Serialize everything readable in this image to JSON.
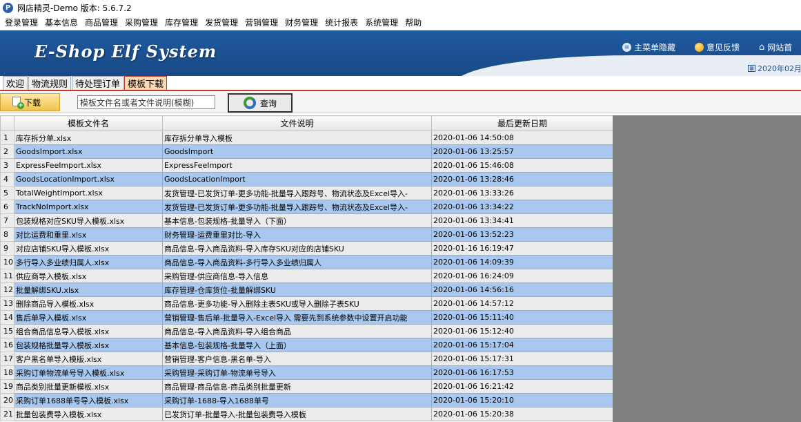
{
  "window": {
    "title": "网店精灵-Demo  版本: 5.6.7.2",
    "icon": "app-logo-icon"
  },
  "menu": [
    "登录管理",
    "基本信息",
    "商品管理",
    "采购管理",
    "库存管理",
    "发货管理",
    "营销管理",
    "财务管理",
    "统计报表",
    "系统管理",
    "帮助"
  ],
  "banner": {
    "logo": "E-Shop Elf System",
    "links": {
      "hide_menu": "主菜单隐藏",
      "feedback": "意见反馈",
      "homepage": "网站首"
    },
    "date": "2020年02月"
  },
  "tabs": [
    "欢迎",
    "物流规则",
    "待处理订单",
    "模板下载"
  ],
  "active_tab": 3,
  "toolbar": {
    "download_label": "下载",
    "search_value": "模板文件名或者文件说明(模糊)",
    "query_label": "查询"
  },
  "table": {
    "headers": [
      "",
      "模板文件名",
      "文件说明",
      "最后更新日期"
    ],
    "rows": [
      [
        "1",
        "库存拆分单.xlsx",
        "库存拆分单导入模板",
        "2020-01-06 14:50:08"
      ],
      [
        "2",
        "GoodsImport.xlsx",
        "GoodsImport",
        "2020-01-06 13:25:57"
      ],
      [
        "3",
        "ExpressFeeImport.xlsx",
        "ExpressFeeImport",
        "2020-01-06 15:46:08"
      ],
      [
        "4",
        "GoodsLocationImport.xlsx",
        "GoodsLocationImport",
        "2020-01-06 13:28:46"
      ],
      [
        "5",
        "TotalWeightImport.xlsx",
        "发货管理-已发货订单-更多功能-批量导入跟踪号、物流状态及Excel导入-",
        "2020-01-06 13:33:26"
      ],
      [
        "6",
        "TrackNoImport.xlsx",
        "发货管理-已发货订单-更多功能-批量导入跟踪号、物流状态及Excel导入-",
        "2020-01-06 13:34:22"
      ],
      [
        "7",
        "包装规格对应SKU导入模板.xlsx",
        "基本信息-包装规格-批量导入（下面）",
        "2020-01-06 13:34:41"
      ],
      [
        "8",
        "对比运费和重里.xlsx",
        "财务管理-运费重里对比-导入",
        "2020-01-06 13:52:23"
      ],
      [
        "9",
        "对应店铺SKU导入模板.xlsx",
        "商品信息-导入商品资料-导入库存SKU对应的店铺SKU",
        "2020-01-16 16:19:47"
      ],
      [
        "10",
        "多行导入多业绩归属人.xlsx",
        "商品信息-导入商品资料-多行导入多业绩归属人",
        "2020-01-06 14:09:39"
      ],
      [
        "11",
        "供应商导入模板.xlsx",
        "采购管理-供应商信息-导入信息",
        "2020-01-06 16:24:09"
      ],
      [
        "12",
        "批量解绑SKU.xlsx",
        "库存管理-仓库货位-批量解绑SKU",
        "2020-01-06 14:56:16"
      ],
      [
        "13",
        "删除商品导入模板.xlsx",
        "商品信息-更多功能-导入删除主表SKU或导入删除子表SKU",
        "2020-01-06 14:57:12"
      ],
      [
        "14",
        "售后单导入模板.xlsx",
        "营销管理-售后单-批量导入-Excel导入 需要先到系统参数中设置开启功能",
        "2020-01-06 15:11:40"
      ],
      [
        "15",
        "组合商品信息导入模板.xlsx",
        "商品信息-导入商品资料-导入组合商品",
        "2020-01-06 15:12:40"
      ],
      [
        "16",
        "包装规格批量导入模板.xlsx",
        "基本信息-包装规格-批量导入（上面）",
        "2020-01-06 15:17:04"
      ],
      [
        "17",
        "客户黑名单导入模版.xlsx",
        "营销管理-客户信息-黑名单-导入",
        "2020-01-06 15:17:31"
      ],
      [
        "18",
        "采购订单物流单号导入模板.xlsx",
        "采购管理-采购订单-物流单号导入",
        "2020-01-06 16:17:53"
      ],
      [
        "19",
        "商品类别批量更新模板.xlsx",
        "商品管理-商品信息-商品类别批量更新",
        "2020-01-06 16:21:42"
      ],
      [
        "20",
        "采购订单1688单号导入模板.xlsx",
        "采购订单-1688-导入1688单号",
        "2020-01-06 15:20:10"
      ],
      [
        "21",
        "批量包装费导入模板.xlsx",
        "已发货订单-批量导入-批量包装费导入模板",
        "2020-01-06 15:20:38"
      ]
    ]
  },
  "colors": {
    "banner": "#1f5aa0",
    "row_alt": "#a8c8f0",
    "row": "#ececec",
    "tab_active": "#ffd9b3",
    "side_panel": "#808080"
  }
}
